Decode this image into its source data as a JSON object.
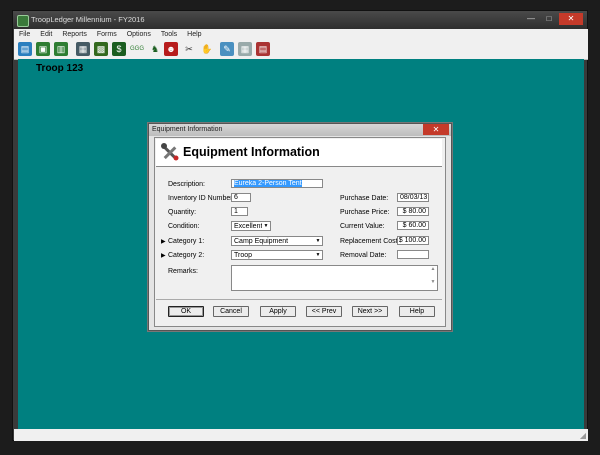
{
  "app": {
    "title": "TroopLedger Millennium - FY2016",
    "menu": [
      "File",
      "Edit",
      "Reports",
      "Forms",
      "Options",
      "Tools",
      "Help"
    ],
    "toolbar_icons": [
      "open-folder-icon",
      "save-icon",
      "print-icon",
      "table-icon",
      "calculator-icon",
      "money-bag-icon",
      "ggg-icon",
      "scout-icon",
      "person-icon",
      "tools-icon",
      "handshake-icon",
      "ledger-icon",
      "grid-icon",
      "report-icon"
    ],
    "workspace_title": "Troop 123",
    "window_buttons": {
      "minimize": "—",
      "maximize": "□",
      "close": "✕"
    }
  },
  "dialog": {
    "window_title": "Equipment Information",
    "header_title": "Equipment Information",
    "close_glyph": "✕",
    "fields": {
      "description": {
        "label": "Description:",
        "value": "Eureka 2-Person Tent"
      },
      "inventory_id": {
        "label": "Inventory ID Number:",
        "value": "6"
      },
      "quantity": {
        "label": "Quantity:",
        "value": "1"
      },
      "condition": {
        "label": "Condition:",
        "value": "Excellent"
      },
      "category1": {
        "label": "Category 1:",
        "value": "Camp Equipment"
      },
      "category2": {
        "label": "Category 2:",
        "value": "Troop"
      },
      "remarks": {
        "label": "Remarks:",
        "value": ""
      },
      "purchase_date": {
        "label": "Purchase Date:",
        "value": "08/03/13"
      },
      "purchase_price": {
        "label": "Purchase Price:",
        "value": "$ 80.00"
      },
      "current_value": {
        "label": "Current Value:",
        "value": "$ 60.00"
      },
      "replacement_cost": {
        "label": "Replacement Cost:",
        "value": "$ 100.00"
      },
      "removal_date": {
        "label": "Removal Date:",
        "value": ""
      }
    },
    "buttons": {
      "ok": "OK",
      "cancel": "Cancel",
      "apply": "Apply",
      "prev": "<< Prev",
      "next": "Next >>",
      "help": "Help"
    }
  }
}
